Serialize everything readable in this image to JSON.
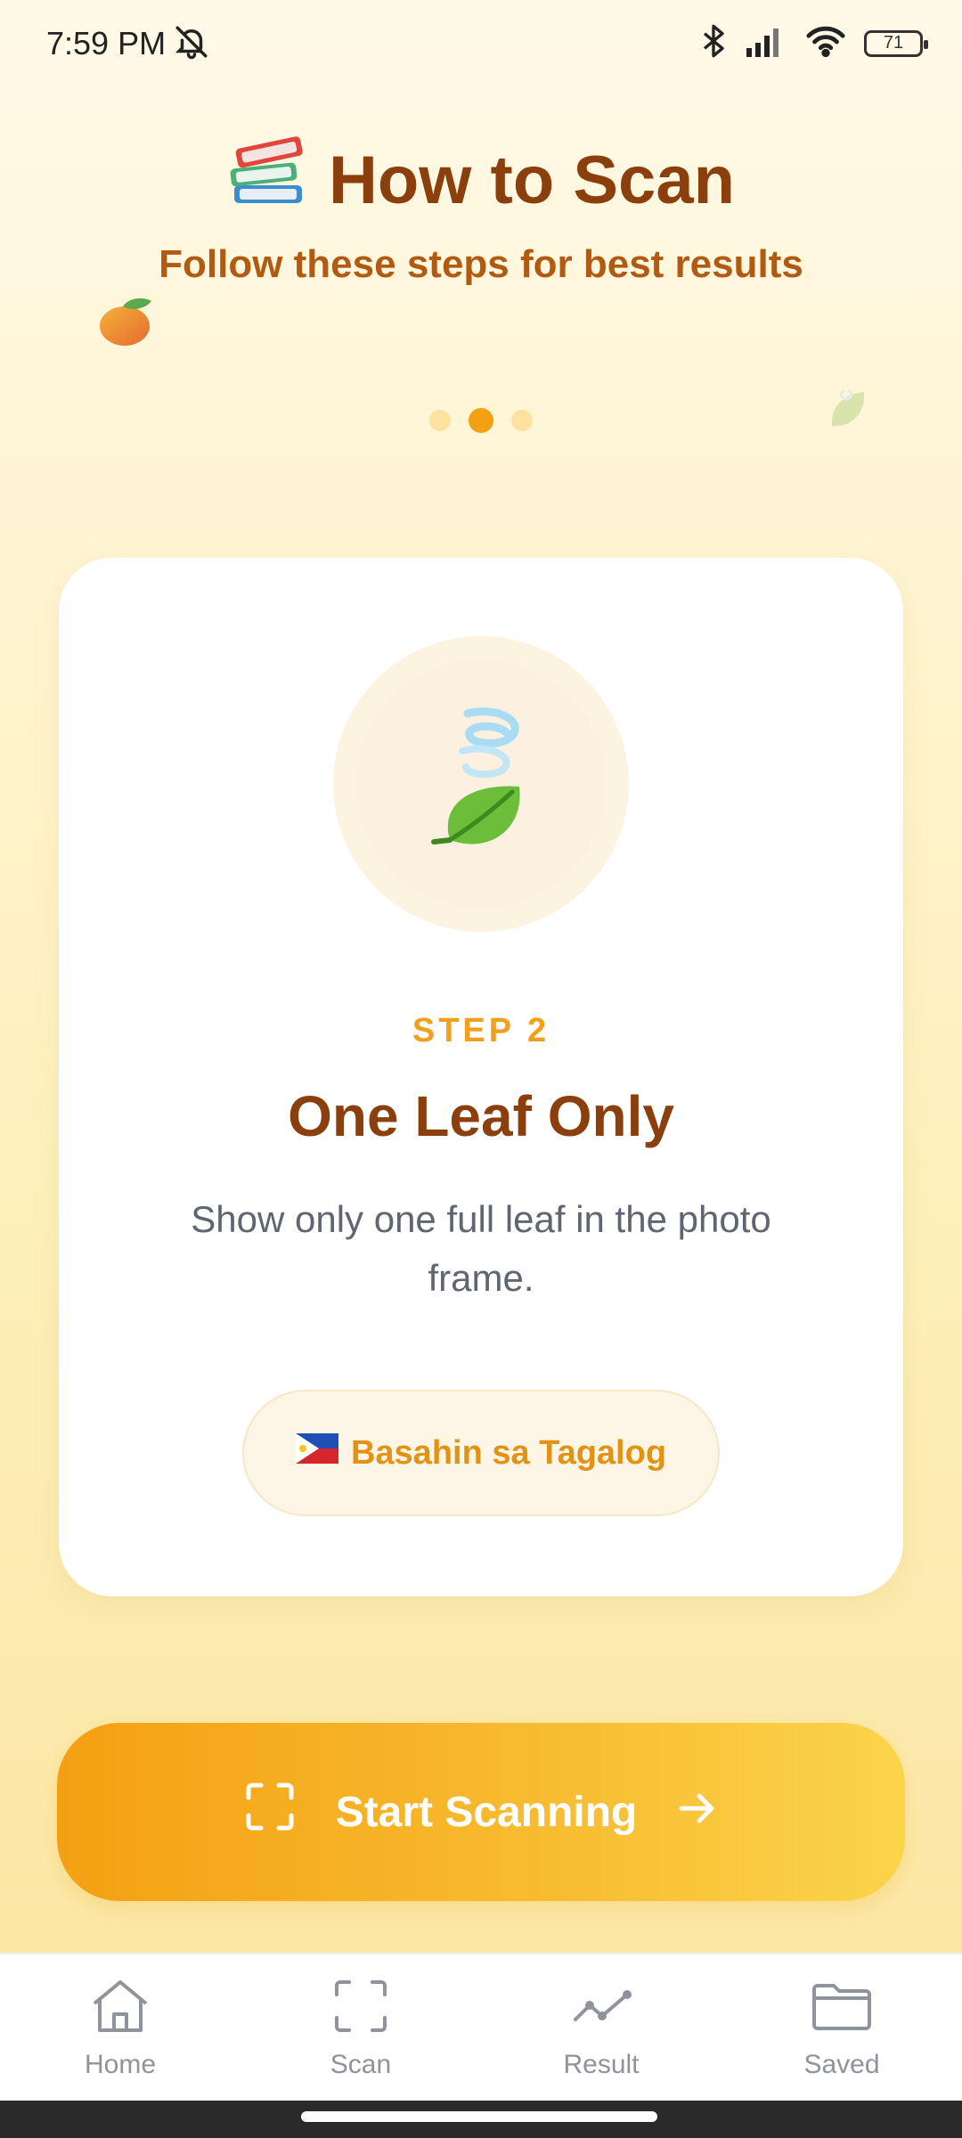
{
  "status_bar": {
    "time": "7:59 PM",
    "battery": "71"
  },
  "header": {
    "title": "How to Scan",
    "subtitle": "Follow these steps for best results"
  },
  "pager": {
    "count": 3,
    "active_index": 1
  },
  "step_card": {
    "step_label": "STEP 2",
    "title": "One Leaf Only",
    "description": "Show only one full leaf in the photo frame.",
    "language_button": "Basahin sa Tagalog"
  },
  "primary_action": {
    "label": "Start Scanning"
  },
  "bottom_nav": [
    {
      "label": "Home",
      "icon": "home-icon"
    },
    {
      "label": "Scan",
      "icon": "scan-icon"
    },
    {
      "label": "Result",
      "icon": "result-icon"
    },
    {
      "label": "Saved",
      "icon": "folder-icon"
    }
  ],
  "colors": {
    "accent": "#f3a013",
    "title": "#8a3f0c",
    "subtitle": "#b35a12",
    "nav": "#8e939c"
  }
}
